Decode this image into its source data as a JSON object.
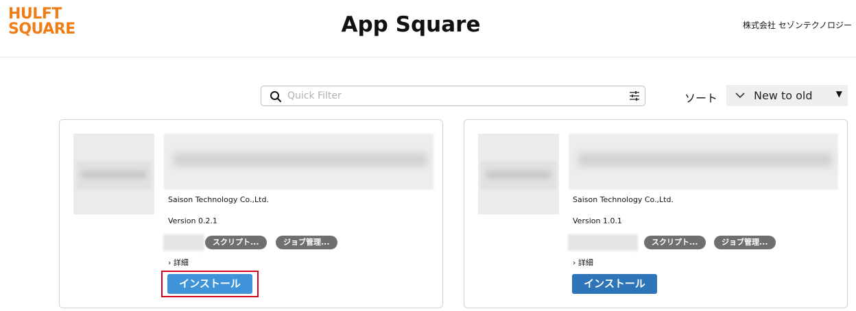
{
  "header": {
    "logo_line1": "HULFT",
    "logo_line2": "SQUARE",
    "title": "App Square",
    "company": "株式会社 セゾンテクノロジー"
  },
  "filter": {
    "placeholder": "Quick Filter",
    "value": ""
  },
  "sort": {
    "label": "ソート",
    "selected": "New to old"
  },
  "cards": [
    {
      "publisher": "Saison Technology Co.,Ltd.",
      "version": "Version 0.2.1",
      "tags": [
        "スクリプト...",
        "ジョブ管理..."
      ],
      "detail_label": "詳細",
      "install_label": "インストール"
    },
    {
      "publisher": "Saison Technology Co.,Ltd.",
      "version": "Version 1.0.1",
      "tags": [
        "スクリプト...",
        "ジョブ管理..."
      ],
      "detail_label": "詳細",
      "install_label": "インストール"
    }
  ],
  "colors": {
    "brand": "#f07c16",
    "install_primary": "#3f93d8",
    "install": "#2d74b8",
    "tag": "#6f6f6f",
    "highlight": "#d0021b"
  }
}
